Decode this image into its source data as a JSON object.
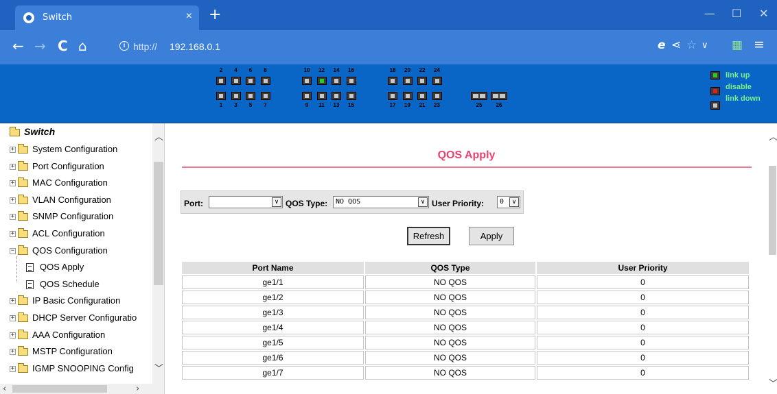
{
  "browser": {
    "tab_title": "Switch",
    "tab_close": "×",
    "new_tab": "+",
    "minimize": "—",
    "maximize": "☐",
    "close": "✕",
    "back": "←",
    "forward": "→",
    "reload": "C",
    "home": "⌂",
    "info": "i",
    "url_scheme": "http://",
    "url_host": "192.168.0.1",
    "icons": [
      "info-icon",
      "ie-mode-icon",
      "share-icon",
      "star-icon",
      "chevron-down-icon",
      "extensions-icon",
      "menu-icon"
    ]
  },
  "device_panel": {
    "top_numbers": [
      "2",
      "4",
      "6",
      "8",
      "10",
      "12",
      "14",
      "16",
      "18",
      "20",
      "22",
      "24"
    ],
    "bottom_numbers": [
      "1",
      "3",
      "5",
      "7",
      "9",
      "11",
      "13",
      "15",
      "17",
      "19",
      "21",
      "23",
      "25",
      "26"
    ],
    "ports_up": [
      12
    ],
    "legend": {
      "up": "link up",
      "disable": "disable",
      "down": "link down"
    },
    "colors": {
      "up": "#22d022",
      "disable": "#e02020",
      "down": "#c8c8c8",
      "panel": "#0966c6"
    }
  },
  "sidebar": {
    "root": "Switch",
    "items": [
      {
        "label": "System Configuration",
        "expanded": false
      },
      {
        "label": "Port Configuration",
        "expanded": false
      },
      {
        "label": "MAC Configuration",
        "expanded": false
      },
      {
        "label": "VLAN Configuration",
        "expanded": false
      },
      {
        "label": "SNMP Configuration",
        "expanded": false
      },
      {
        "label": "ACL Configuration",
        "expanded": false
      },
      {
        "label": "QOS Configuration",
        "expanded": true
      },
      {
        "label": "IP Basic Configuration",
        "expanded": false
      },
      {
        "label": "DHCP Server Configuratio",
        "expanded": false
      },
      {
        "label": "AAA Configuration",
        "expanded": false
      },
      {
        "label": "MSTP Configuration",
        "expanded": false
      },
      {
        "label": "IGMP SNOOPING Config",
        "expanded": false
      }
    ],
    "qos_children": [
      "QOS Apply",
      "QOS Schedule"
    ],
    "plus": "+",
    "minus": "−"
  },
  "main": {
    "title": "QOS Apply",
    "filters": {
      "port_label": "Port:",
      "port_value": "",
      "qos_type_label": "QOS Type:",
      "qos_type_value": "NO QOS",
      "user_priority_label": "User Priority:",
      "user_priority_value": "0"
    },
    "buttons": {
      "refresh": "Refresh",
      "apply": "Apply"
    },
    "table": {
      "headers": [
        "Port Name",
        "QOS Type",
        "User Priority"
      ],
      "rows": [
        [
          "ge1/1",
          "NO QOS",
          "0"
        ],
        [
          "ge1/2",
          "NO QOS",
          "0"
        ],
        [
          "ge1/3",
          "NO QOS",
          "0"
        ],
        [
          "ge1/4",
          "NO QOS",
          "0"
        ],
        [
          "ge1/5",
          "NO QOS",
          "0"
        ],
        [
          "ge1/6",
          "NO QOS",
          "0"
        ],
        [
          "ge1/7",
          "NO QOS",
          "0"
        ]
      ]
    },
    "accent_color": "#e8436e"
  }
}
